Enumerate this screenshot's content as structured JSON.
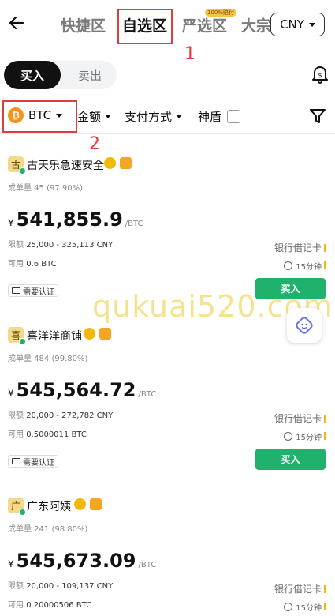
{
  "header": {
    "tabs": [
      "快捷区",
      "自选区",
      "严选区",
      "大宗"
    ],
    "active_tab": "自选区",
    "promo_badge": "100%赔付",
    "currency": "CNY"
  },
  "annotations": {
    "label1": "1",
    "label2": "2"
  },
  "toggle": {
    "buy": "买入",
    "sell": "卖出"
  },
  "filters": {
    "coin": "BTC",
    "coin_symbol": "₿",
    "amount": "金额",
    "payment": "支付方式",
    "shield": "神盾"
  },
  "ads": [
    {
      "avatar": "古",
      "name": "古天乐急速安全",
      "stats": "成单量 45 (97.90%)",
      "yen": "¥",
      "price": "541,855.9",
      "unit": "/BTC",
      "limit_label": "限额",
      "limit": "25,000 - 325,113 CNY",
      "avail_label": "可用",
      "avail": "0.6 BTC",
      "payment": "银行借记卡",
      "time": "15分钟",
      "verify": "需要认证",
      "buy": "买入"
    },
    {
      "avatar": "喜",
      "name": "喜洋洋商铺",
      "stats": "成单量 484 (99.80%)",
      "yen": "¥",
      "price": "545,564.72",
      "unit": "/BTC",
      "limit_label": "限额",
      "limit": "20,000 - 272,782 CNY",
      "avail_label": "可用",
      "avail": "0.5000011 BTC",
      "payment": "银行借记卡",
      "time": "15分钟",
      "verify": "需要认证",
      "buy": "买入"
    },
    {
      "avatar": "广",
      "name": "广东阿姨",
      "stats": "成单量 241 (98.80%)",
      "yen": "¥",
      "price": "545,673.09",
      "unit": "/BTC",
      "limit_label": "限额",
      "limit": "20,000 - 109,137 CNY",
      "avail_label": "可用",
      "avail": "0.20000506 BTC",
      "payment": "银行借记卡",
      "time": "15分钟"
    }
  ],
  "watermark": "qukuai520.com",
  "colors": {
    "green": "#20b26c",
    "highlight": "#e23b3b",
    "btc": "#f7931a"
  }
}
